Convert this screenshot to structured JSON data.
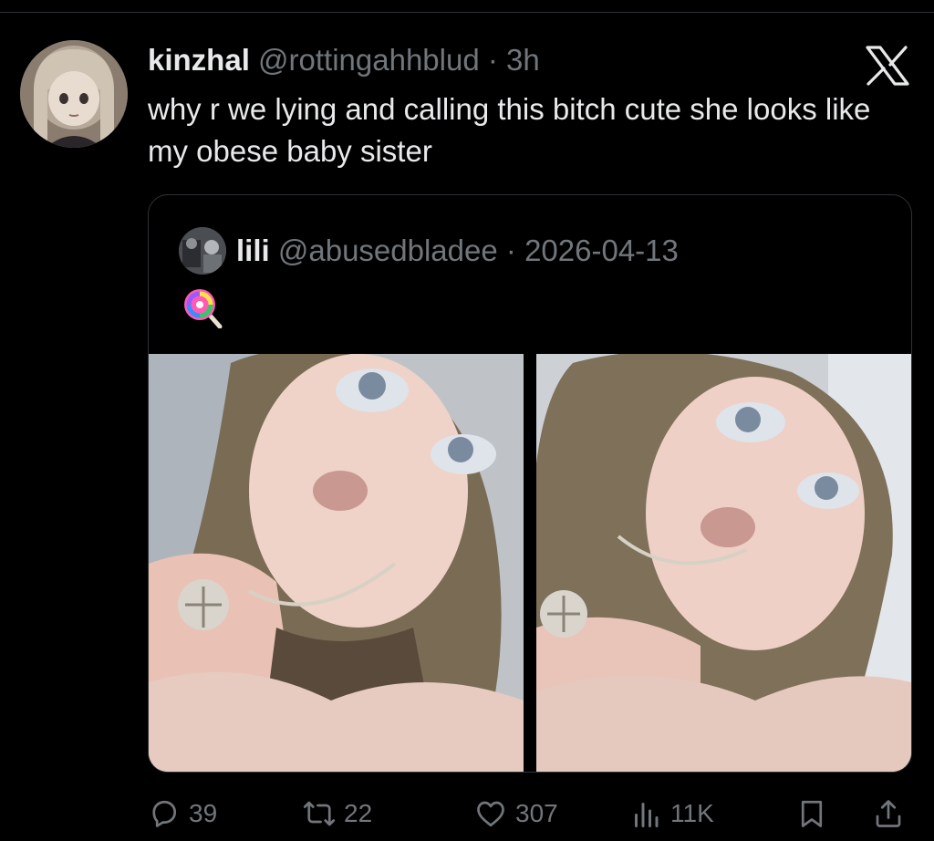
{
  "tweet": {
    "display_name": "kinzhal",
    "handle": "@rottingahhblud",
    "separator": "·",
    "time": "3h",
    "text": "why r we lying and calling this bitch cute she looks like my obese baby sister"
  },
  "quoted_tweet": {
    "display_name": "lili",
    "handle": "@abusedbladee",
    "separator": "·",
    "date": "2026-04-13",
    "emoji": "lollipop-icon",
    "media_count": 2
  },
  "actions": {
    "replies": "39",
    "reposts": "22",
    "likes": "307",
    "views": "11K"
  },
  "colors": {
    "background": "#000000",
    "text_primary": "#e7e9ea",
    "text_muted": "#71767b",
    "border": "#2f3336"
  }
}
